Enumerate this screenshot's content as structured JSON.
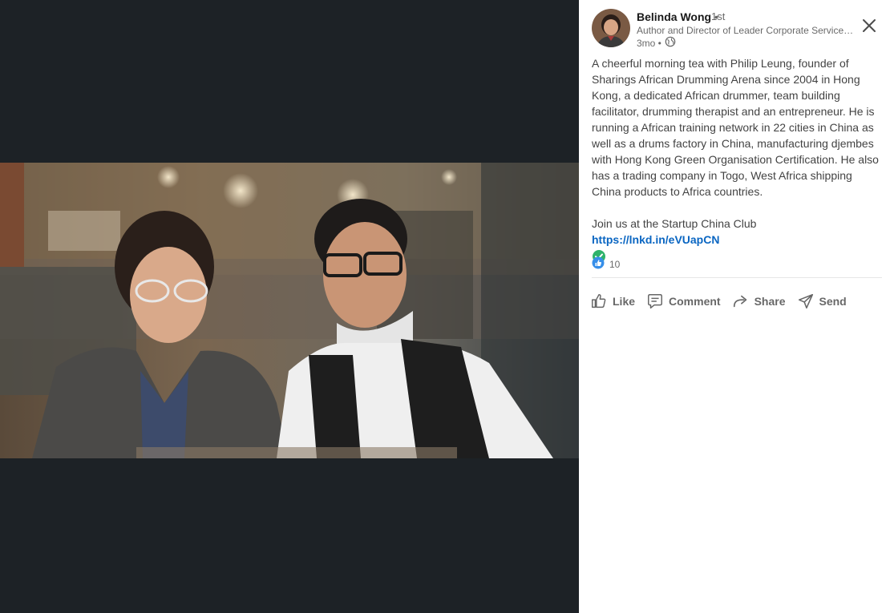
{
  "post": {
    "author": {
      "name": "Belinda Wong",
      "separator": "•",
      "degree": "1st",
      "headline": "Author and Director of Leader Corporate Services Limited",
      "time": "3mo •",
      "visibility_icon": "globe-icon"
    },
    "text": "A cheerful morning tea with Philip Leung, founder of Sharings African Drumming Arena since 2004 in Hong Kong, a dedicated African drummer, team building facilitator, drumming therapist and an entrepreneur. He is running a African training network in 22 cities in China as well as a drums factory in China, manufacturing djembes with Hong Kong Green Organisation Certification. He also has a trading company in Togo, West Africa shipping China products to Africa countries.",
    "cta_text": "Join us at the Startup China Club ",
    "cta_link": "https://lnkd.in/eVUapCN",
    "reaction_count": "10"
  },
  "actions": {
    "like": "Like",
    "comment": "Comment",
    "share": "Share",
    "send": "Send"
  },
  "colors": {
    "viewer_bg": "#1d2226",
    "link": "#0a66c2",
    "check": "#2fb36b",
    "like_blue": "#378fe9"
  }
}
